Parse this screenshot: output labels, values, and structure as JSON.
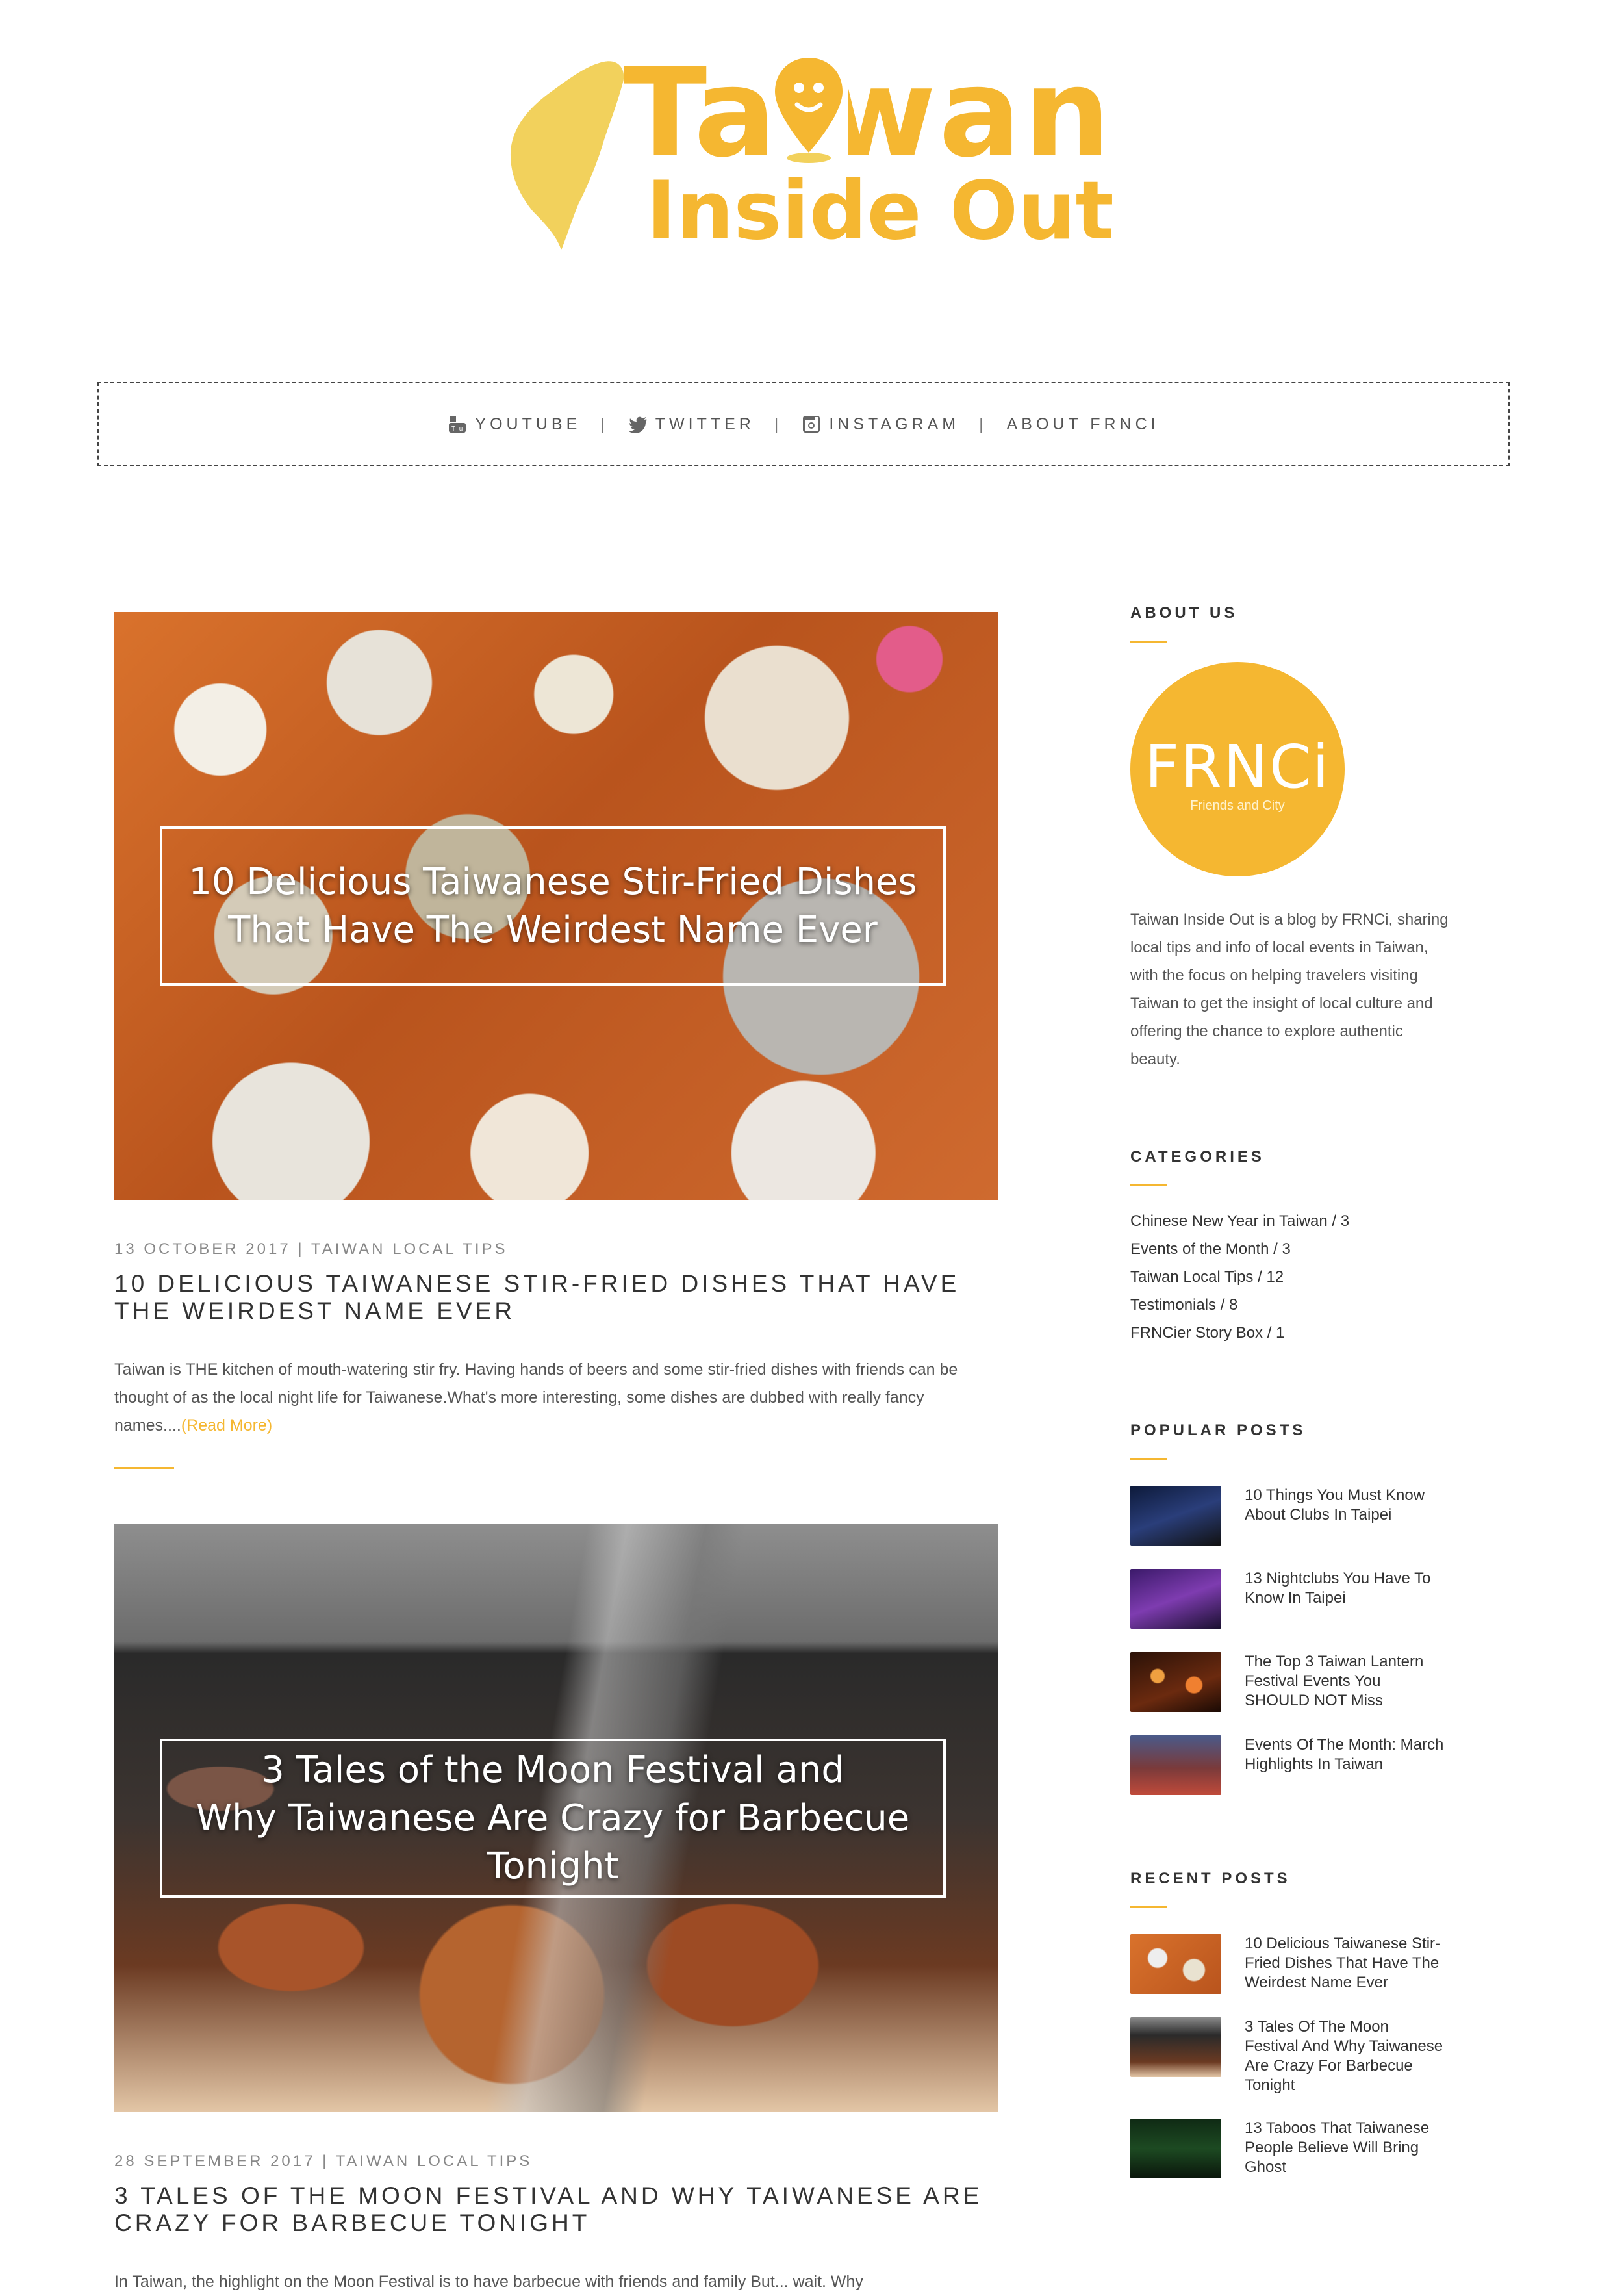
{
  "logo": {
    "line1": "Taiwan",
    "line2": "Inside Out"
  },
  "nav": {
    "youtube": "YOUTUBE",
    "twitter": "TWITTER",
    "instagram": "INSTAGRAM",
    "about": "ABOUT FRNCI",
    "separator": "|"
  },
  "posts": [
    {
      "image_title_line1": "10 Delicious Taiwanese Stir-Fried Dishes",
      "image_title_line2": "That Have The Weirdest Name Ever",
      "date": "13 OCTOBER 2017",
      "separator": "|",
      "category": "TAIWAN LOCAL TIPS",
      "title": "10 DELICIOUS TAIWANESE STIR-FRIED DISHES THAT HAVE THE WEIRDEST NAME EVER",
      "excerpt": "Taiwan is THE kitchen of mouth-watering stir fry. Having hands of beers and some stir-fried dishes with friends can be thought of as the local night life for Taiwanese.What's more interesting, some dishes are dubbed with really fancy names....",
      "read_more": "(Read More)"
    },
    {
      "image_title_line1": "3 Tales of the Moon Festival and",
      "image_title_line2": "Why Taiwanese Are Crazy for Barbecue Tonight",
      "date": "28 SEPTEMBER 2017",
      "separator": "|",
      "category": "TAIWAN LOCAL TIPS",
      "title": "3 TALES OF THE MOON FESTIVAL AND WHY TAIWANESE ARE CRAZY FOR BARBECUE TONIGHT",
      "excerpt": "In Taiwan, the highlight on the Moon Festival is to have barbecue with friends and family But... wait. Why"
    }
  ],
  "sidebar": {
    "about": {
      "title": "ABOUT US",
      "badge_brand": "FRNCi",
      "badge_tagline": "Friends and City",
      "text": "Taiwan Inside Out is a blog by FRNCi, sharing local tips and info of local events in Taiwan, with the focus on helping travelers visiting Taiwan to get the insight of local culture and offering the chance to explore authentic beauty."
    },
    "categories": {
      "title": "CATEGORIES",
      "items": [
        "Chinese New Year in Taiwan / 3",
        "Events of the Month / 3",
        "Taiwan Local Tips / 12",
        "Testimonials / 8",
        "FRNCier Story Box / 1"
      ]
    },
    "popular": {
      "title": "POPULAR POSTS",
      "items": [
        "10 Things You Must Know About Clubs In Taipei",
        "13 Nightclubs You Have To Know In Taipei",
        "The Top 3 Taiwan Lantern Festival Events You SHOULD NOT Miss",
        "Events Of The Month: March Highlights In Taiwan"
      ]
    },
    "recent": {
      "title": "RECENT POSTS",
      "items": [
        "10 Delicious Taiwanese Stir-Fried Dishes That Have The Weirdest Name Ever",
        "3 Tales Of The Moon Festival And Why Taiwanese Are Crazy For Barbecue Tonight",
        "13 Taboos That Taiwanese People Believe Will Bring Ghost"
      ]
    }
  },
  "colors": {
    "accent": "#f5b731",
    "island": "#f2d15c",
    "text": "#333333",
    "muted": "#888888"
  }
}
